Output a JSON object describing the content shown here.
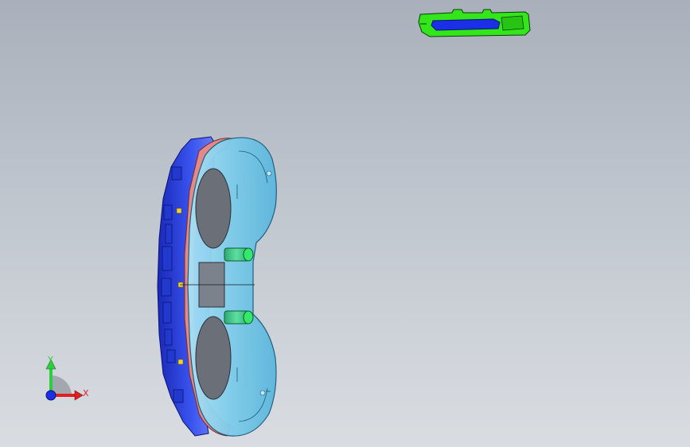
{
  "viewport": {
    "background_top": "#a9b0bb",
    "background_bottom": "#d9dde2"
  },
  "parts": {
    "bracket": {
      "name": "bracket",
      "color": "#33e61a",
      "accent": "#1a2fe6"
    },
    "cluster_housing": {
      "name": "cluster-housing",
      "color": "#2a3de0"
    },
    "cluster_lens": {
      "name": "cluster-lens",
      "color": "#8fd3ee"
    },
    "cluster_bezel": {
      "name": "cluster-bezel",
      "color": "#e08a8a"
    },
    "bosses": {
      "color": "#3ad27a"
    }
  },
  "triad": {
    "y_label": "Y",
    "x_label": "X",
    "y_color": "#2ecc40",
    "x_color": "#e02020",
    "z_color": "#1a2fe6"
  }
}
